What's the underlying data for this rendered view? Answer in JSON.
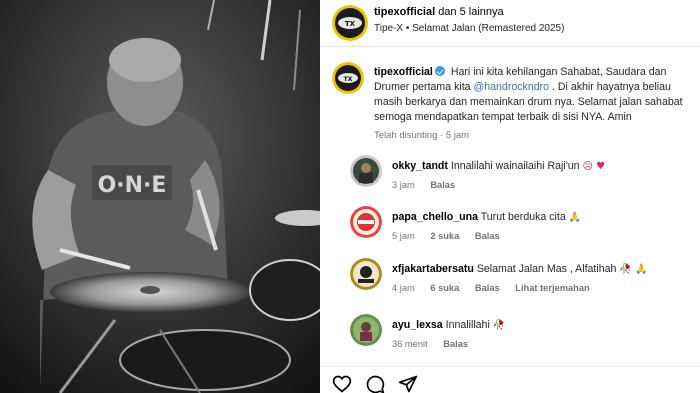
{
  "header": {
    "username": "tipexofficial",
    "others": "dan 5 lainnya",
    "subtitle": "Tipe-X • Selamat Jalan (Remastered 2025)"
  },
  "caption": {
    "username": "tipexofficial",
    "line1": "Hari ini kita kehilangan Sahabat, Saudara dan",
    "line2_pre": "Drumer pertama kita ",
    "mention": "@handrockndro",
    "line2_post": " . Di akhir hayatnya beliau",
    "line3": "masih berkarya dan memainkan drum nya. Selamat jalan sahabat",
    "line4": "semoga mendapatkan tempat terbaik di sisi NYA. Amin",
    "meta": "Telah disunting · 5 jam"
  },
  "comments": [
    {
      "username": "okky_tandt",
      "text": "Innalilahi wainailaihi Raji'un",
      "emoji": "☹ ♥",
      "time": "3 jam",
      "likes": "",
      "reply": "Balas",
      "translate": ""
    },
    {
      "username": "papa_chello_una",
      "text": "Turut berduka cita",
      "emoji": "🙏",
      "time": "5 jam",
      "likes": "2 suka",
      "reply": "Balas",
      "translate": ""
    },
    {
      "username": "xfjakartabersatu",
      "text": "Selamat Jalan Mas , Alfatihah",
      "emoji": "🥀 🙏",
      "time": "4 jam",
      "likes": "6 suka",
      "reply": "Balas",
      "translate": "Lihat terjemahan"
    },
    {
      "username": "ayu_lexsa",
      "text": "Innalillahi",
      "emoji": "🥀",
      "time": "36 menit",
      "likes": "",
      "reply": "Balas",
      "translate": ""
    }
  ],
  "actions": [
    "heart-icon",
    "comment-icon",
    "share-icon"
  ],
  "colors": {
    "link": "#3b6fb6",
    "verified": "#3897f0",
    "muted": "#737373"
  },
  "photo_watermark": "O·N·E"
}
